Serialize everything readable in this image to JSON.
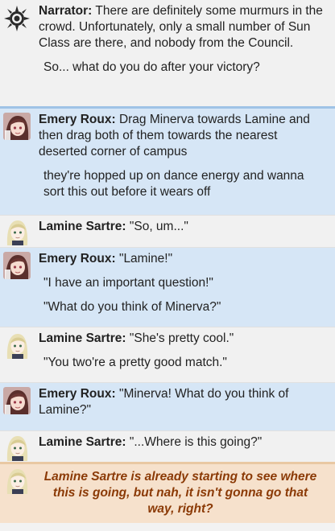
{
  "messages": [
    {
      "speaker": "Narrator:",
      "avatar": "sun-icon",
      "first": "There are definitely some murmurs in the crowd. Unfortunately, only a small number of Sun Class are there, and nobody from the Council.",
      "lines": [
        "So... what do you do after your victory?"
      ]
    },
    {
      "speaker": "Emery Roux:",
      "avatar": "emery-portrait",
      "first": "Drag Minerva towards Lamine and then drag both of them towards the nearest deserted corner of campus",
      "lines": [
        "they're hopped up on dance energy and wanna sort this out before it wears off"
      ]
    },
    {
      "speaker": "Lamine Sartre:",
      "avatar": "lamine-portrait",
      "first": "\"So, um...\"",
      "lines": []
    },
    {
      "speaker": "Emery Roux:",
      "avatar": "emery-portrait",
      "first": "\"Lamine!\"",
      "lines": [
        "\"I have an important question!\"",
        "\"What do you think of Minerva?\""
      ]
    },
    {
      "speaker": "Lamine Sartre:",
      "avatar": "lamine-portrait",
      "first": "\"She's pretty cool.\"",
      "lines": [
        "\"You two're a pretty good match.\""
      ]
    },
    {
      "speaker": "Emery Roux:",
      "avatar": "emery-portrait",
      "first": "\"Minerva! What do you think of Lamine?\"",
      "lines": []
    },
    {
      "speaker": "Lamine Sartre:",
      "avatar": "lamine-portrait",
      "first": "\"...Where is this going?\"",
      "lines": []
    },
    {
      "avatar": "lamine-portrait",
      "system": "Lamine Sartre is already starting to see where this is going, but nah, it isn't gonna go that way, right?"
    }
  ],
  "colors": {
    "emery_bg": "#d6e6f6",
    "narrator_bg": "#f1f1f1",
    "system_bg": "#f6e1cc",
    "system_text": "#8b3a06"
  }
}
